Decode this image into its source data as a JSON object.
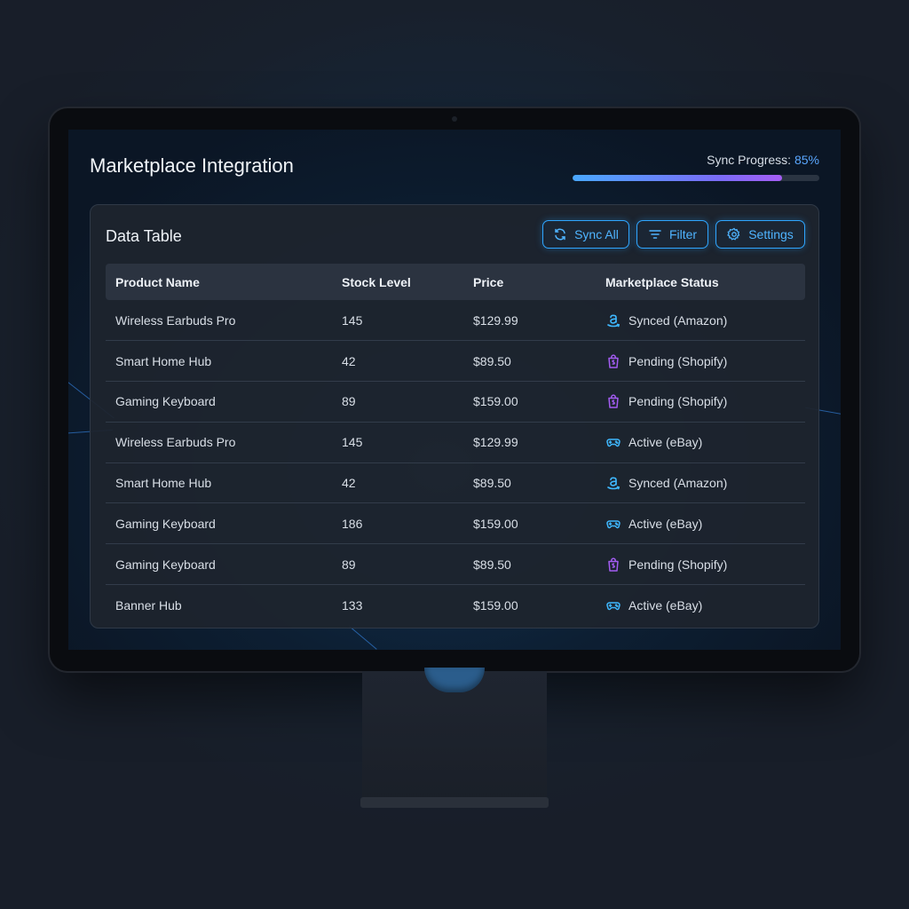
{
  "app": {
    "title": "Marketplace Integration"
  },
  "sync": {
    "label": "Sync Progress:",
    "value": "85%",
    "progress": 0.85
  },
  "card": {
    "title": "Data Table"
  },
  "toolbar": {
    "sync_all": "Sync All",
    "filter": "Filter",
    "settings": "Settings"
  },
  "table": {
    "columns": [
      "Product Name",
      "Stock Level",
      "Price",
      "Marketplace Status"
    ],
    "rows": [
      {
        "product": "Wireless Earbuds Pro",
        "stock": "145",
        "price": "$129.99",
        "status": "Synced (Amazon)",
        "icon": "amazon-icon"
      },
      {
        "product": "Smart Home Hub",
        "stock": "42",
        "price": "$89.50",
        "status": "Pending (Shopify)",
        "icon": "shopify-icon"
      },
      {
        "product": "Gaming Keyboard",
        "stock": "89",
        "price": "$159.00",
        "status": "Pending (Shopify)",
        "icon": "shopify-icon"
      },
      {
        "product": "Wireless Earbuds Pro",
        "stock": "145",
        "price": "$129.99",
        "status": "Active (eBay)",
        "icon": "ebay-icon"
      },
      {
        "product": "Smart Home Hub",
        "stock": "42",
        "price": "$89.50",
        "status": "Synced (Amazon)",
        "icon": "amazon-icon"
      },
      {
        "product": "Gaming Keyboard",
        "stock": "186",
        "price": "$159.00",
        "status": "Active (eBay)",
        "icon": "ebay-icon"
      },
      {
        "product": "Gaming Keyboard",
        "stock": "89",
        "price": "$89.50",
        "status": "Pending (Shopify)",
        "icon": "shopify-icon"
      },
      {
        "product": "Banner Hub",
        "stock": "133",
        "price": "$159.00",
        "status": "Active (eBay)",
        "icon": "ebay-icon"
      }
    ]
  },
  "colors": {
    "accent": "#2fa6ff",
    "amazon": "#3fb8ff",
    "shopify": "#a25cf0",
    "ebay": "#3fb8ff"
  }
}
